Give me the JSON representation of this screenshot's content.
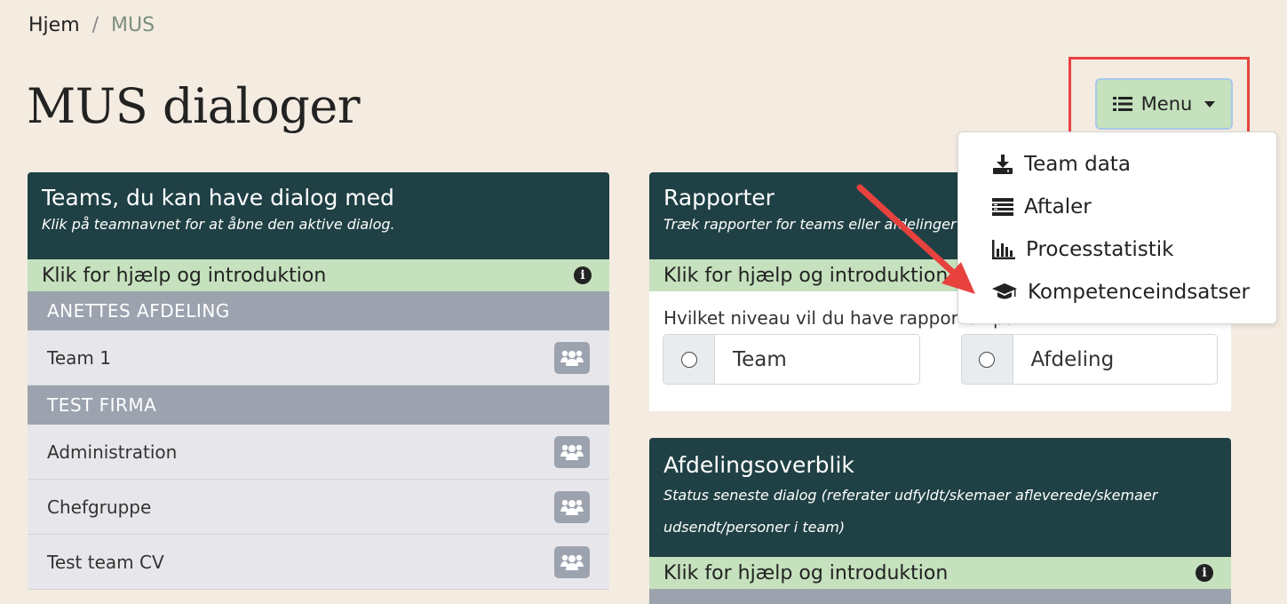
{
  "breadcrumb": {
    "home": "Hjem",
    "separator": "/",
    "current": "MUS"
  },
  "page": {
    "title": "MUS dialoger"
  },
  "menu": {
    "label": "Menu",
    "items": [
      {
        "label": "Team data",
        "icon": "download-icon"
      },
      {
        "label": "Aftaler",
        "icon": "list-icon"
      },
      {
        "label": "Processtatistik",
        "icon": "bar-chart-icon"
      },
      {
        "label": "Kompetenceindsatser",
        "icon": "graduation-cap-icon"
      }
    ]
  },
  "teams_panel": {
    "title": "Teams, du kan have dialog med",
    "subtitle": "Klik på teamnavnet for at åbne den aktive dialog.",
    "help": "Klik for hjælp og introduktion",
    "groups": [
      {
        "name": "ANETTES AFDELING",
        "teams": [
          "Team 1"
        ]
      },
      {
        "name": "TEST FIRMA",
        "teams": [
          "Administration",
          "Chefgruppe",
          "Test team CV"
        ]
      }
    ]
  },
  "reports_panel": {
    "title": "Rapporter",
    "subtitle": "Træk rapporter for teams eller afdelinger",
    "help": "Klik for hjælp og introduktion",
    "question": "Hvilket niveau vil du have rapporten på?",
    "options": [
      "Team",
      "Afdeling"
    ]
  },
  "overview_panel": {
    "title": "Afdelingsoverblik",
    "subtitle": "Status seneste dialog (referater udfyldt/skemaer afleverede/skemaer udsendt/personer i team)",
    "help": "Klik for hjælp og introduktion"
  },
  "colors": {
    "background": "#f4ece1",
    "panel_header": "#1f4044",
    "help_bar": "#c5e1bd",
    "group_header": "#9ca3af",
    "highlight": "#e8423f"
  }
}
